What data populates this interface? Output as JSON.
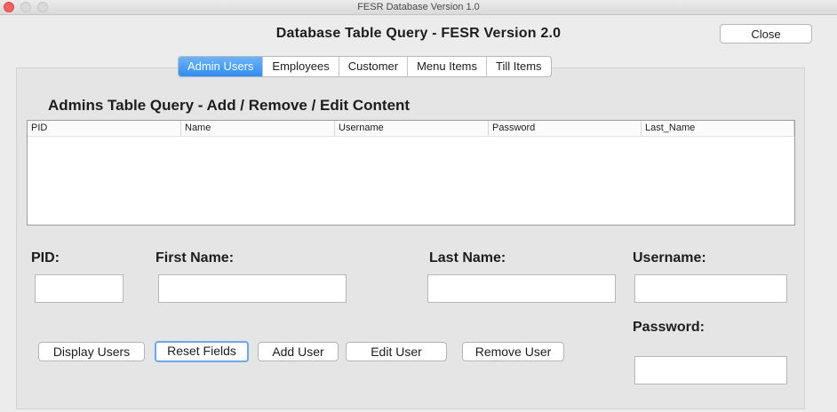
{
  "window": {
    "title": "FESR Database Version 1.0"
  },
  "header": {
    "title": "Database Table Query - FESR Version 2.0",
    "close_label": "Close"
  },
  "tabs": [
    {
      "label": "Admin Users",
      "active": true
    },
    {
      "label": "Employees",
      "active": false
    },
    {
      "label": "Customer",
      "active": false
    },
    {
      "label": "Menu Items",
      "active": false
    },
    {
      "label": "Till Items",
      "active": false
    }
  ],
  "section": {
    "title": "Admins Table Query - Add / Remove / Edit Content"
  },
  "table": {
    "columns": [
      "PID",
      "Name",
      "Username",
      "Password",
      "Last_Name"
    ],
    "rows": []
  },
  "form": {
    "pid_label": "PID:",
    "first_name_label": "First Name:",
    "last_name_label": "Last Name:",
    "username_label": "Username:",
    "password_label": "Password:",
    "pid_value": "",
    "first_name_value": "",
    "last_name_value": "",
    "username_value": "",
    "password_value": ""
  },
  "buttons": {
    "display_users": "Display Users",
    "reset_fields": "Reset Fields",
    "add_user": "Add User",
    "edit_user": "Edit User",
    "remove_user": "Remove User"
  }
}
